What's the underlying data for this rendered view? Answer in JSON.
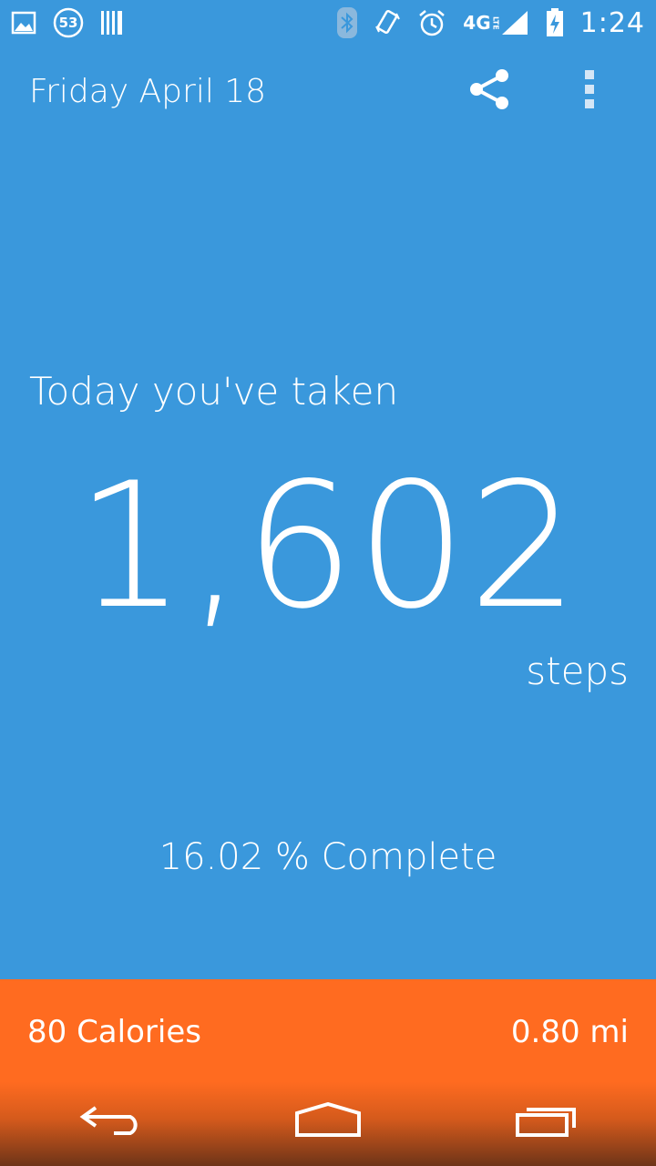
{
  "status_bar": {
    "notification_count": "53",
    "network": "4G",
    "network_sub": "LTE",
    "time": "1:24",
    "icons": [
      "gallery-icon",
      "notification-count-icon",
      "barcode-icon",
      "bluetooth-icon",
      "vibrate-icon",
      "alarm-icon",
      "4g-lte-icon",
      "signal-icon",
      "battery-charging-icon"
    ]
  },
  "header": {
    "date": "Friday April 18",
    "share_icon": "share-icon",
    "menu_icon": "overflow-menu-icon"
  },
  "main": {
    "intro": "Today you've taken",
    "steps_value": "1,602",
    "steps_unit": "steps",
    "completion": "16.02 % Complete",
    "completion_fraction": 0.1602
  },
  "footer": {
    "calories": "80 Calories",
    "distance": "0.80 mi"
  },
  "nav": {
    "icons": [
      "back-icon",
      "home-icon",
      "recent-apps-icon"
    ]
  },
  "colors": {
    "background": "#3a98dc",
    "footer": "#ff6b20",
    "text": "#ffffff"
  }
}
